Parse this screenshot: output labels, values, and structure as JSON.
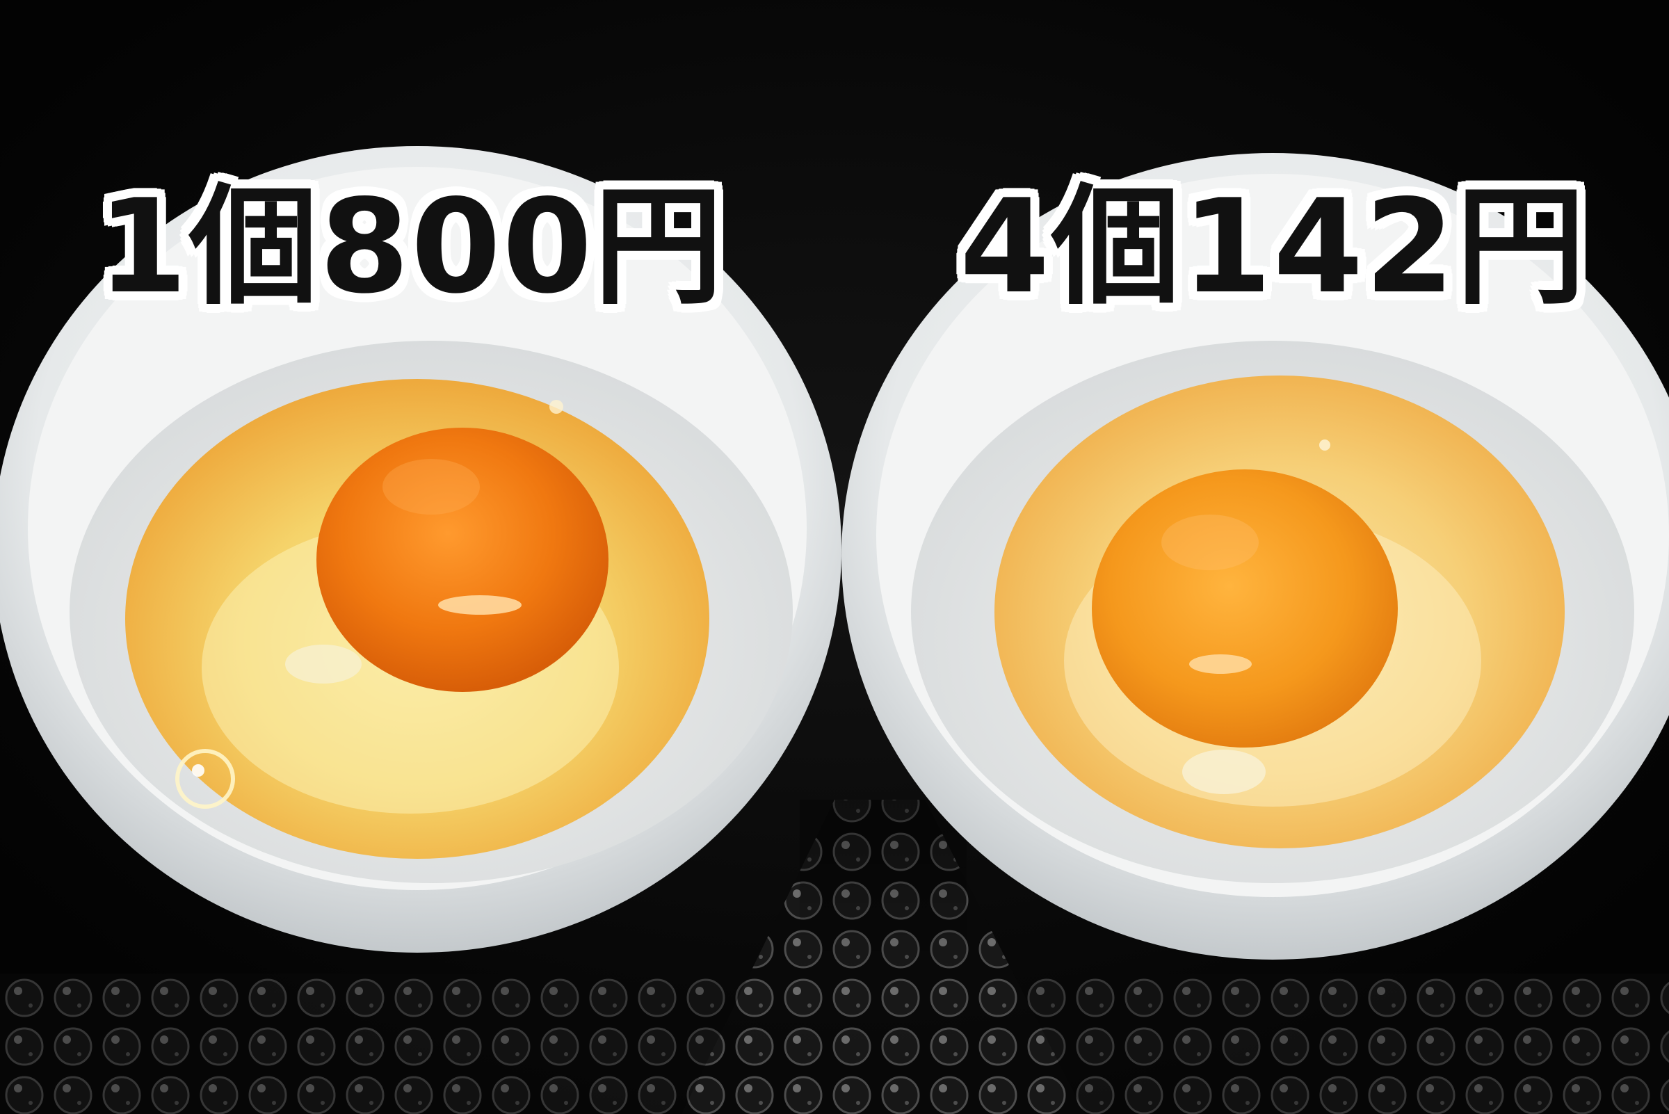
{
  "labels": {
    "left_price": "1個800円",
    "right_price": "4個142円"
  },
  "colors": {
    "background": "#050505",
    "bowl": "#eef0f0",
    "bowl_shadow": "#c9ced0",
    "white_pool": "#f3c85a",
    "left_yolk": "#f07a12",
    "right_yolk": "#f39a1c",
    "label_text": "#111111",
    "label_outline": "#ffffff"
  }
}
